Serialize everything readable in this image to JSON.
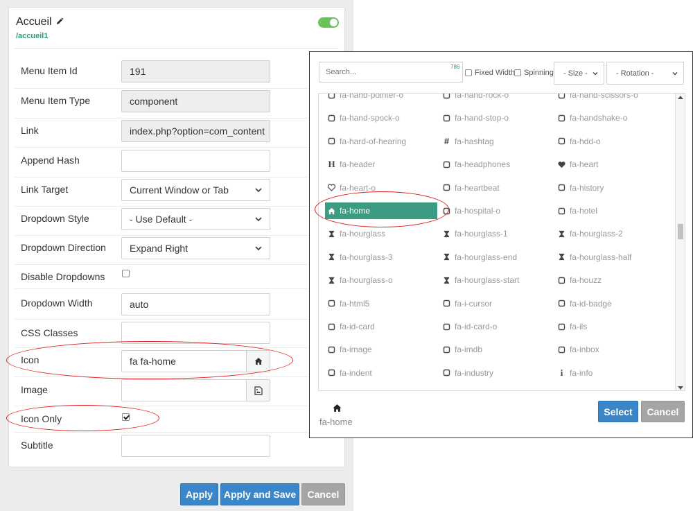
{
  "card": {
    "title": "Accueil",
    "alias": "/accueil1"
  },
  "form": {
    "menu_item_id_label": "Menu Item Id",
    "menu_item_id_value": "191",
    "menu_item_type_label": "Menu Item Type",
    "menu_item_type_value": "component",
    "link_label": "Link",
    "link_value": "index.php?option=com_content",
    "append_hash_label": "Append Hash",
    "append_hash_value": "",
    "link_target_label": "Link Target",
    "link_target_value": "Current Window or Tab",
    "dropdown_style_label": "Dropdown Style",
    "dropdown_style_value": "- Use Default -",
    "dropdown_direction_label": "Dropdown Direction",
    "dropdown_direction_value": "Expand Right",
    "disable_dropdowns_label": "Disable Dropdowns",
    "disable_dropdowns_checked": false,
    "dropdown_width_label": "Dropdown Width",
    "dropdown_width_value": "auto",
    "css_classes_label": "CSS Classes",
    "css_classes_value": "",
    "icon_label": "Icon",
    "icon_value": "fa fa-home",
    "image_label": "Image",
    "image_value": "",
    "icon_only_label": "Icon Only",
    "icon_only_checked": true,
    "subtitle_label": "Subtitle",
    "subtitle_value": ""
  },
  "footer": {
    "apply": "Apply",
    "apply_save": "Apply and Save",
    "cancel": "Cancel"
  },
  "picker": {
    "search_placeholder": "Search...",
    "count": "786",
    "fixed_width_label": "Fixed Width",
    "spinning_label": "Spinning",
    "size_value": "- Size -",
    "rotation_value": "- Rotation -",
    "icons": [
      "fa-hand-pointer-o",
      "fa-hand-rock-o",
      "fa-hand-scissors-o",
      "fa-hand-spock-o",
      "fa-hand-stop-o",
      "fa-handshake-o",
      "fa-hard-of-hearing",
      "fa-hashtag",
      "fa-hdd-o",
      "fa-header",
      "fa-headphones",
      "fa-heart",
      "fa-heart-o",
      "fa-heartbeat",
      "fa-history",
      "fa-home",
      "fa-hospital-o",
      "fa-hotel",
      "fa-hourglass",
      "fa-hourglass-1",
      "fa-hourglass-2",
      "fa-hourglass-3",
      "fa-hourglass-end",
      "fa-hourglass-half",
      "fa-hourglass-o",
      "fa-hourglass-start",
      "fa-houzz",
      "fa-html5",
      "fa-i-cursor",
      "fa-id-badge",
      "fa-id-card",
      "fa-id-card-o",
      "fa-ils",
      "fa-image",
      "fa-imdb",
      "fa-inbox",
      "fa-indent",
      "fa-industry",
      "fa-info"
    ],
    "selected_icon": "fa-home",
    "preview_label": "fa-home",
    "select_button": "Select",
    "cancel_button": "Cancel"
  },
  "colors": {
    "accent_green": "#3d9b83",
    "button_blue": "#3a86c8",
    "button_grey": "#a5a5a5",
    "annotation_red": "#e02020",
    "toggle_on": "#6ac259"
  }
}
